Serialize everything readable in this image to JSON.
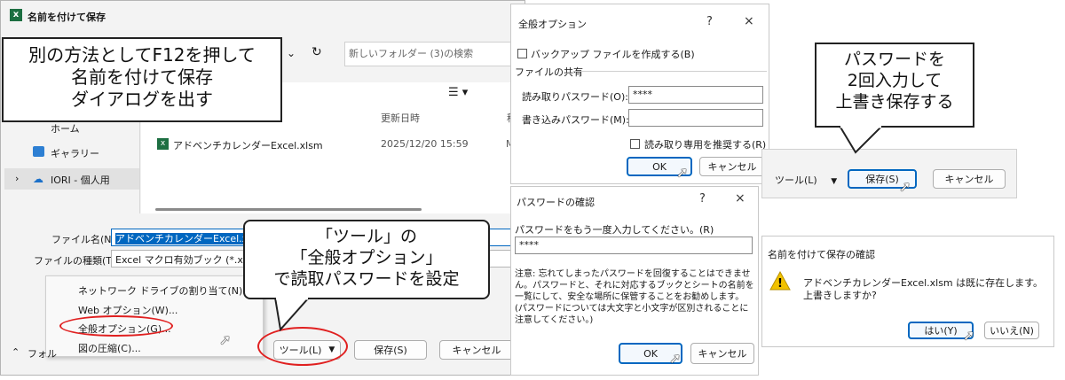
{
  "save_dialog": {
    "title": "名前を付けて保存",
    "search_placeholder": "新しいフォルダー (3)の検索",
    "column_date": "更新日時",
    "column_type": "種",
    "nav_home": "ホーム",
    "nav_gallery": "ギャラリー",
    "nav_user": "IORI - 個人用",
    "file_name": "アドベンチカレンダーExcel.xlsm",
    "file_date": "2025/12/20 15:59",
    "file_type_short": "M",
    "filename_label": "ファイル名(N):",
    "filename_value": "アドベンチカレンダーExcel.xlsm",
    "filetype_label": "ファイルの種類(T):",
    "filetype_value": "Excel マクロ有効ブック (*.xlsm)",
    "folder_hide": "フォル",
    "tools_button": "ツール(L)",
    "save_button": "保存(S)",
    "cancel_button": "キャンセル",
    "menu": [
      "ネットワーク ドライブの割り当て(N)...",
      "Web オプション(W)...",
      "全般オプション(G)...",
      "図の圧縮(C)..."
    ]
  },
  "general_options": {
    "title": "全般オプション",
    "help": "?",
    "close": "×",
    "backup_label": "バックアップ ファイルを作成する(B)",
    "sharing_header": "ファイルの共有",
    "read_pw_label": "読み取りパスワード(O):",
    "read_pw_value": "****",
    "write_pw_label": "書き込みパスワード(M):",
    "write_pw_value": "",
    "readonly_label": "読み取り専用を推奨する(R)",
    "ok": "OK",
    "cancel": "キャンセル"
  },
  "confirm_password": {
    "title": "パスワードの確認",
    "help": "?",
    "close": "×",
    "prompt": "パスワードをもう一度入力してください。(R)",
    "value": "****",
    "note": "注意: 忘れてしまったパスワードを回復することはできません。パスワードと、それに対応するブックとシートの名前を一覧にして、安全な場所に保管することをお勧めします。(パスワードについては大文字と小文字が区別されることに注意してください。)",
    "ok": "OK",
    "cancel": "キャンセル"
  },
  "save_bar": {
    "tools": "ツール(L)",
    "save": "保存(S)",
    "cancel": "キャンセル"
  },
  "overwrite_confirm": {
    "title": "名前を付けて保存の確認",
    "message_line1": "アドベンチカレンダーExcel.xlsm は既に存在します。",
    "message_line2": "上書きしますか?",
    "yes": "はい(Y)",
    "no": "いいえ(N)"
  },
  "callouts": {
    "f12": [
      "別の方法としてF12を押して",
      "名前を付けて保存",
      "ダイアログを出す"
    ],
    "tools": [
      "「ツール」の",
      "「全般オプション」",
      "で読取パスワードを設定"
    ],
    "password": [
      "パスワードを",
      "2回入力して",
      "上書き保存する"
    ]
  },
  "colors": {
    "accent": "#0067c0",
    "highlight": "#cce4f7",
    "callout_red": "#e02020",
    "warning": "#f2c200"
  }
}
